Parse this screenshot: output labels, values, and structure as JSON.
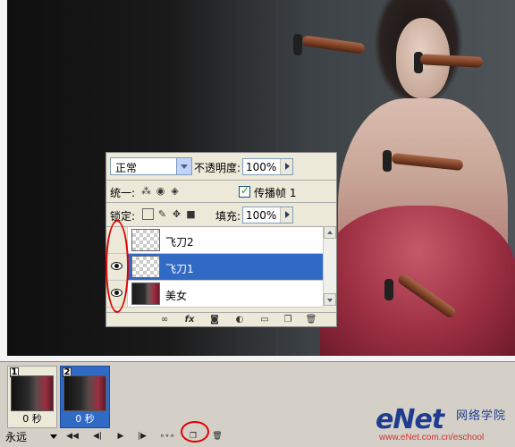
{
  "layers_panel": {
    "blend_mode": "正常",
    "opacity_label": "不透明度:",
    "opacity_value": "100%",
    "unify_label": "统一:",
    "propagate_label": "传播帧 1",
    "lock_label": "锁定:",
    "fill_label": "填充:",
    "fill_value": "100%",
    "layers": [
      {
        "name": "飞刀2",
        "visible": false,
        "selected": false,
        "thumb": "transparent"
      },
      {
        "name": "飞刀1",
        "visible": true,
        "selected": true,
        "thumb": "transparent"
      },
      {
        "name": "美女",
        "visible": true,
        "selected": false,
        "thumb": "photo"
      }
    ],
    "footer_icons": [
      "link-icon",
      "fx-icon",
      "mask-icon",
      "adjustment-icon",
      "group-folder-icon",
      "new-layer-icon",
      "trash-icon"
    ]
  },
  "animation": {
    "frames": [
      {
        "number": "1",
        "delay": "0 秒",
        "selected": false
      },
      {
        "number": "2",
        "delay": "0 秒",
        "selected": true
      }
    ],
    "loop_value": "永远"
  },
  "watermark": {
    "brand": "eNet",
    "cn": "网络学院",
    "url": "www.eNet.com.cn/eschool"
  },
  "colors": {
    "selection": "#316ac5",
    "highlight_oval": "#e00000"
  }
}
